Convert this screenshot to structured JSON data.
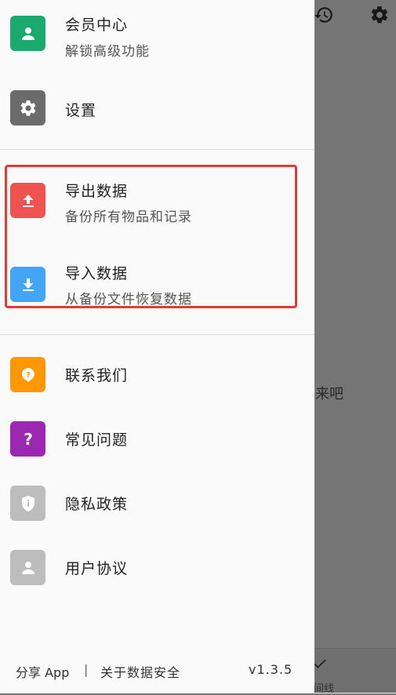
{
  "background": {
    "empty_text_fragment": "来吧",
    "bottom_tab_fragment": "间线",
    "icons": [
      "history-icon",
      "gear-icon",
      "check-icon"
    ]
  },
  "drawer": {
    "items": [
      {
        "title": "会员中心",
        "subtitle": "解锁高级功能",
        "icon": "person-icon",
        "color": "#1aaa6e"
      },
      {
        "title": "设置",
        "icon": "gear-icon",
        "color": "#6b6b6b"
      },
      {
        "title": "导出数据",
        "subtitle": "备份所有物品和记录",
        "icon": "upload-icon",
        "color": "#ef5350"
      },
      {
        "title": "导入数据",
        "subtitle": "从备份文件恢复数据",
        "icon": "download-icon",
        "color": "#42a5f5"
      },
      {
        "title": "联系我们",
        "icon": "support-icon",
        "color": "#ff9800"
      },
      {
        "title": "常见问题",
        "icon": "question-icon",
        "color": "#9c27b0"
      },
      {
        "title": "隐私政策",
        "icon": "shield-icon",
        "color": "#bdbdbd"
      },
      {
        "title": "用户协议",
        "icon": "person-icon",
        "color": "#bdbdbd"
      }
    ],
    "highlight_color": "#e53935"
  },
  "footer": {
    "share": "分享 App",
    "separator": "|",
    "data_security": "关于数据安全",
    "version": "v1.3.5"
  }
}
